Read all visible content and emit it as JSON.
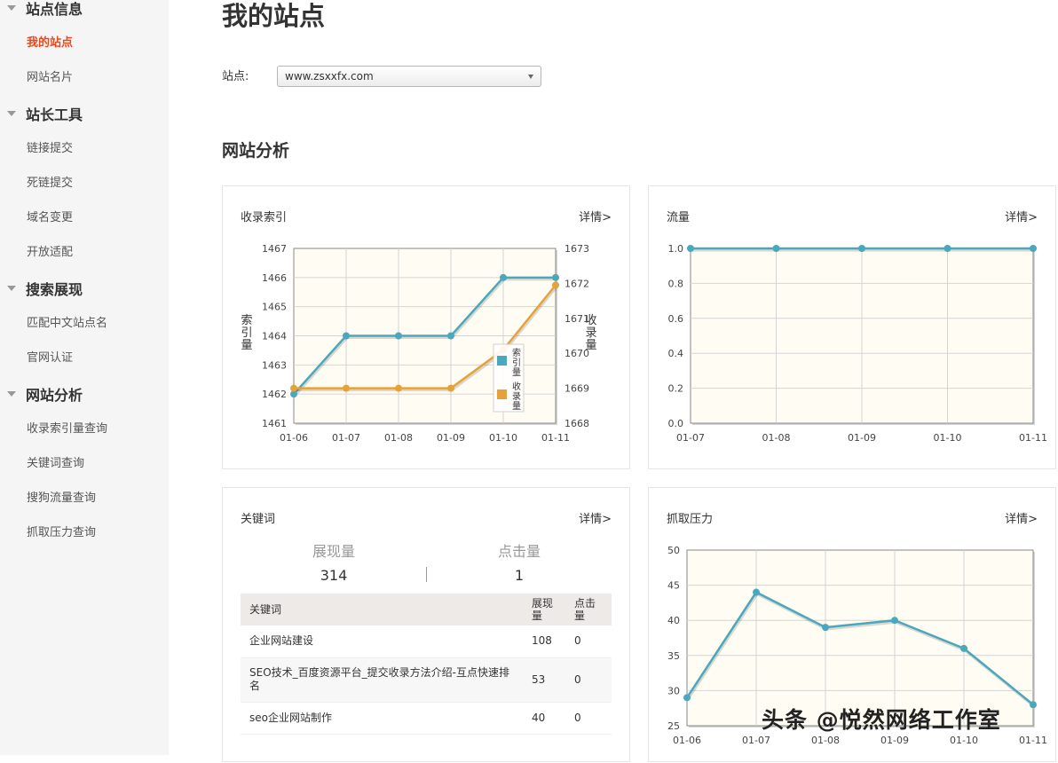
{
  "sidebar": {
    "sections": [
      {
        "label": "站点信息",
        "items": [
          "我的站点",
          "网站名片"
        ]
      },
      {
        "label": "站长工具",
        "items": [
          "链接提交",
          "死链提交",
          "域名变更",
          "开放适配"
        ]
      },
      {
        "label": "搜索展现",
        "items": [
          "匹配中文站点名",
          "官网认证"
        ]
      },
      {
        "label": "网站分析",
        "items": [
          "收录索引量查询",
          "关键词查询",
          "搜狗流量查询",
          "抓取压力查询"
        ]
      }
    ]
  },
  "header": {
    "title": "我的站点"
  },
  "site_select": {
    "label": "站点:",
    "value": "www.zsxxfx.com"
  },
  "analysis": {
    "title": "网站分析"
  },
  "cards": {
    "index": {
      "title": "收录索引",
      "more": "详情>"
    },
    "traffic": {
      "title": "流量",
      "more": "详情>"
    },
    "keywords": {
      "title": "关键词",
      "more": "详情>"
    },
    "crawl": {
      "title": "抓取压力",
      "more": "详情>"
    }
  },
  "keyword_summary": {
    "impressions_label": "展现量",
    "impressions_value": "314",
    "clicks_label": "点击量",
    "clicks_value": "1"
  },
  "keyword_table": {
    "headers": [
      "关键词",
      "展现量",
      "点击量"
    ],
    "rows": [
      [
        "企业网站建设",
        "108",
        "0"
      ],
      [
        "SEO技术_百度资源平台_提交收录方法介绍-互点快速排名",
        "53",
        "0"
      ],
      [
        "seo企业网站制作",
        "40",
        "0"
      ]
    ]
  },
  "colors": {
    "accent": "#e8481d",
    "series_blue": "#4aa8bd",
    "series_orange": "#e5a23a",
    "plot_bg": "#fffdf3"
  },
  "watermark": "头条 @悦然网络工作室",
  "chart_data": [
    {
      "type": "line",
      "x": [
        "01-06",
        "01-07",
        "01-08",
        "01-09",
        "01-10",
        "01-11"
      ],
      "series": [
        {
          "name": "索引量",
          "axis": "left",
          "color": "#4aa8bd",
          "values": [
            1462,
            1464,
            1464,
            1464,
            1466,
            1466
          ]
        },
        {
          "name": "收录量",
          "axis": "right",
          "color": "#e5a23a",
          "values": [
            1669,
            1669,
            1669,
            1669,
            1670.1,
            1671.95
          ]
        }
      ],
      "ylabel": "索引量",
      "y2label": "收录量",
      "ylim": [
        1461,
        1467
      ],
      "y2lim": [
        1668,
        1673
      ],
      "yticks": [
        1461,
        1462,
        1463,
        1464,
        1465,
        1466,
        1467
      ],
      "y2ticks": [
        1668,
        1669,
        1670,
        1671,
        1672,
        1673
      ],
      "legend": "inside right",
      "grid": true
    },
    {
      "type": "line",
      "x": [
        "01-07",
        "01-08",
        "01-09",
        "01-10",
        "01-11"
      ],
      "series": [
        {
          "color": "#4aa8bd",
          "values": [
            1.0,
            1.0,
            1.0,
            1.0,
            1.0
          ]
        }
      ],
      "ylim": [
        0,
        1
      ],
      "yticks": [
        "0.0",
        "0.2",
        "0.4",
        "0.6",
        "0.8",
        "1.0"
      ],
      "grid": true
    },
    {
      "type": "line",
      "x": [
        "01-06",
        "01-07",
        "01-08",
        "01-09",
        "01-10",
        "01-11"
      ],
      "series": [
        {
          "color": "#4aa8bd",
          "values": [
            29,
            44,
            39,
            40,
            36,
            28
          ]
        }
      ],
      "ylim": [
        25,
        50
      ],
      "yticks": [
        25,
        30,
        35,
        40,
        45,
        50
      ],
      "grid": true
    }
  ]
}
